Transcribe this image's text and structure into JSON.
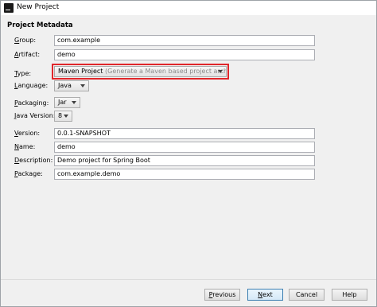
{
  "window": {
    "title": "New Project",
    "icon": "intellij-icon"
  },
  "section_title": "Project Metadata",
  "fields": {
    "group": {
      "label_u": "G",
      "label_rest": "roup:",
      "value": "com.example"
    },
    "artifact": {
      "label_u": "A",
      "label_rest": "rtifact:",
      "value": "demo"
    },
    "type": {
      "label_u": "T",
      "label_rest": "ype:",
      "value": "Maven Project",
      "hint": "(Generate a Maven based project archive)"
    },
    "language": {
      "label_u": "L",
      "label_rest": "anguage:",
      "value": "Java"
    },
    "packaging": {
      "label_u": "P",
      "label_rest": "ackaging:",
      "value": "Jar"
    },
    "java_version": {
      "label_u": "J",
      "label_rest": "ava Version:",
      "value": "8"
    },
    "version": {
      "label_u": "V",
      "label_rest": "ersion:",
      "value": "0.0.1-SNAPSHOT"
    },
    "name": {
      "label_u": "N",
      "label_rest": "ame:",
      "value": "demo"
    },
    "description": {
      "label_u": "D",
      "label_rest": "escription:",
      "value": "Demo project for Spring Boot"
    },
    "package": {
      "label_u": "P",
      "label_rest": "ackage:",
      "value": "com.example.demo"
    }
  },
  "buttons": {
    "previous": {
      "u": "P",
      "rest": "revious"
    },
    "next": {
      "u": "N",
      "rest": "ext"
    },
    "cancel": "Cancel",
    "help": "Help"
  },
  "colors": {
    "highlight": "#e0262a",
    "primary_border": "#3c7fb1"
  }
}
